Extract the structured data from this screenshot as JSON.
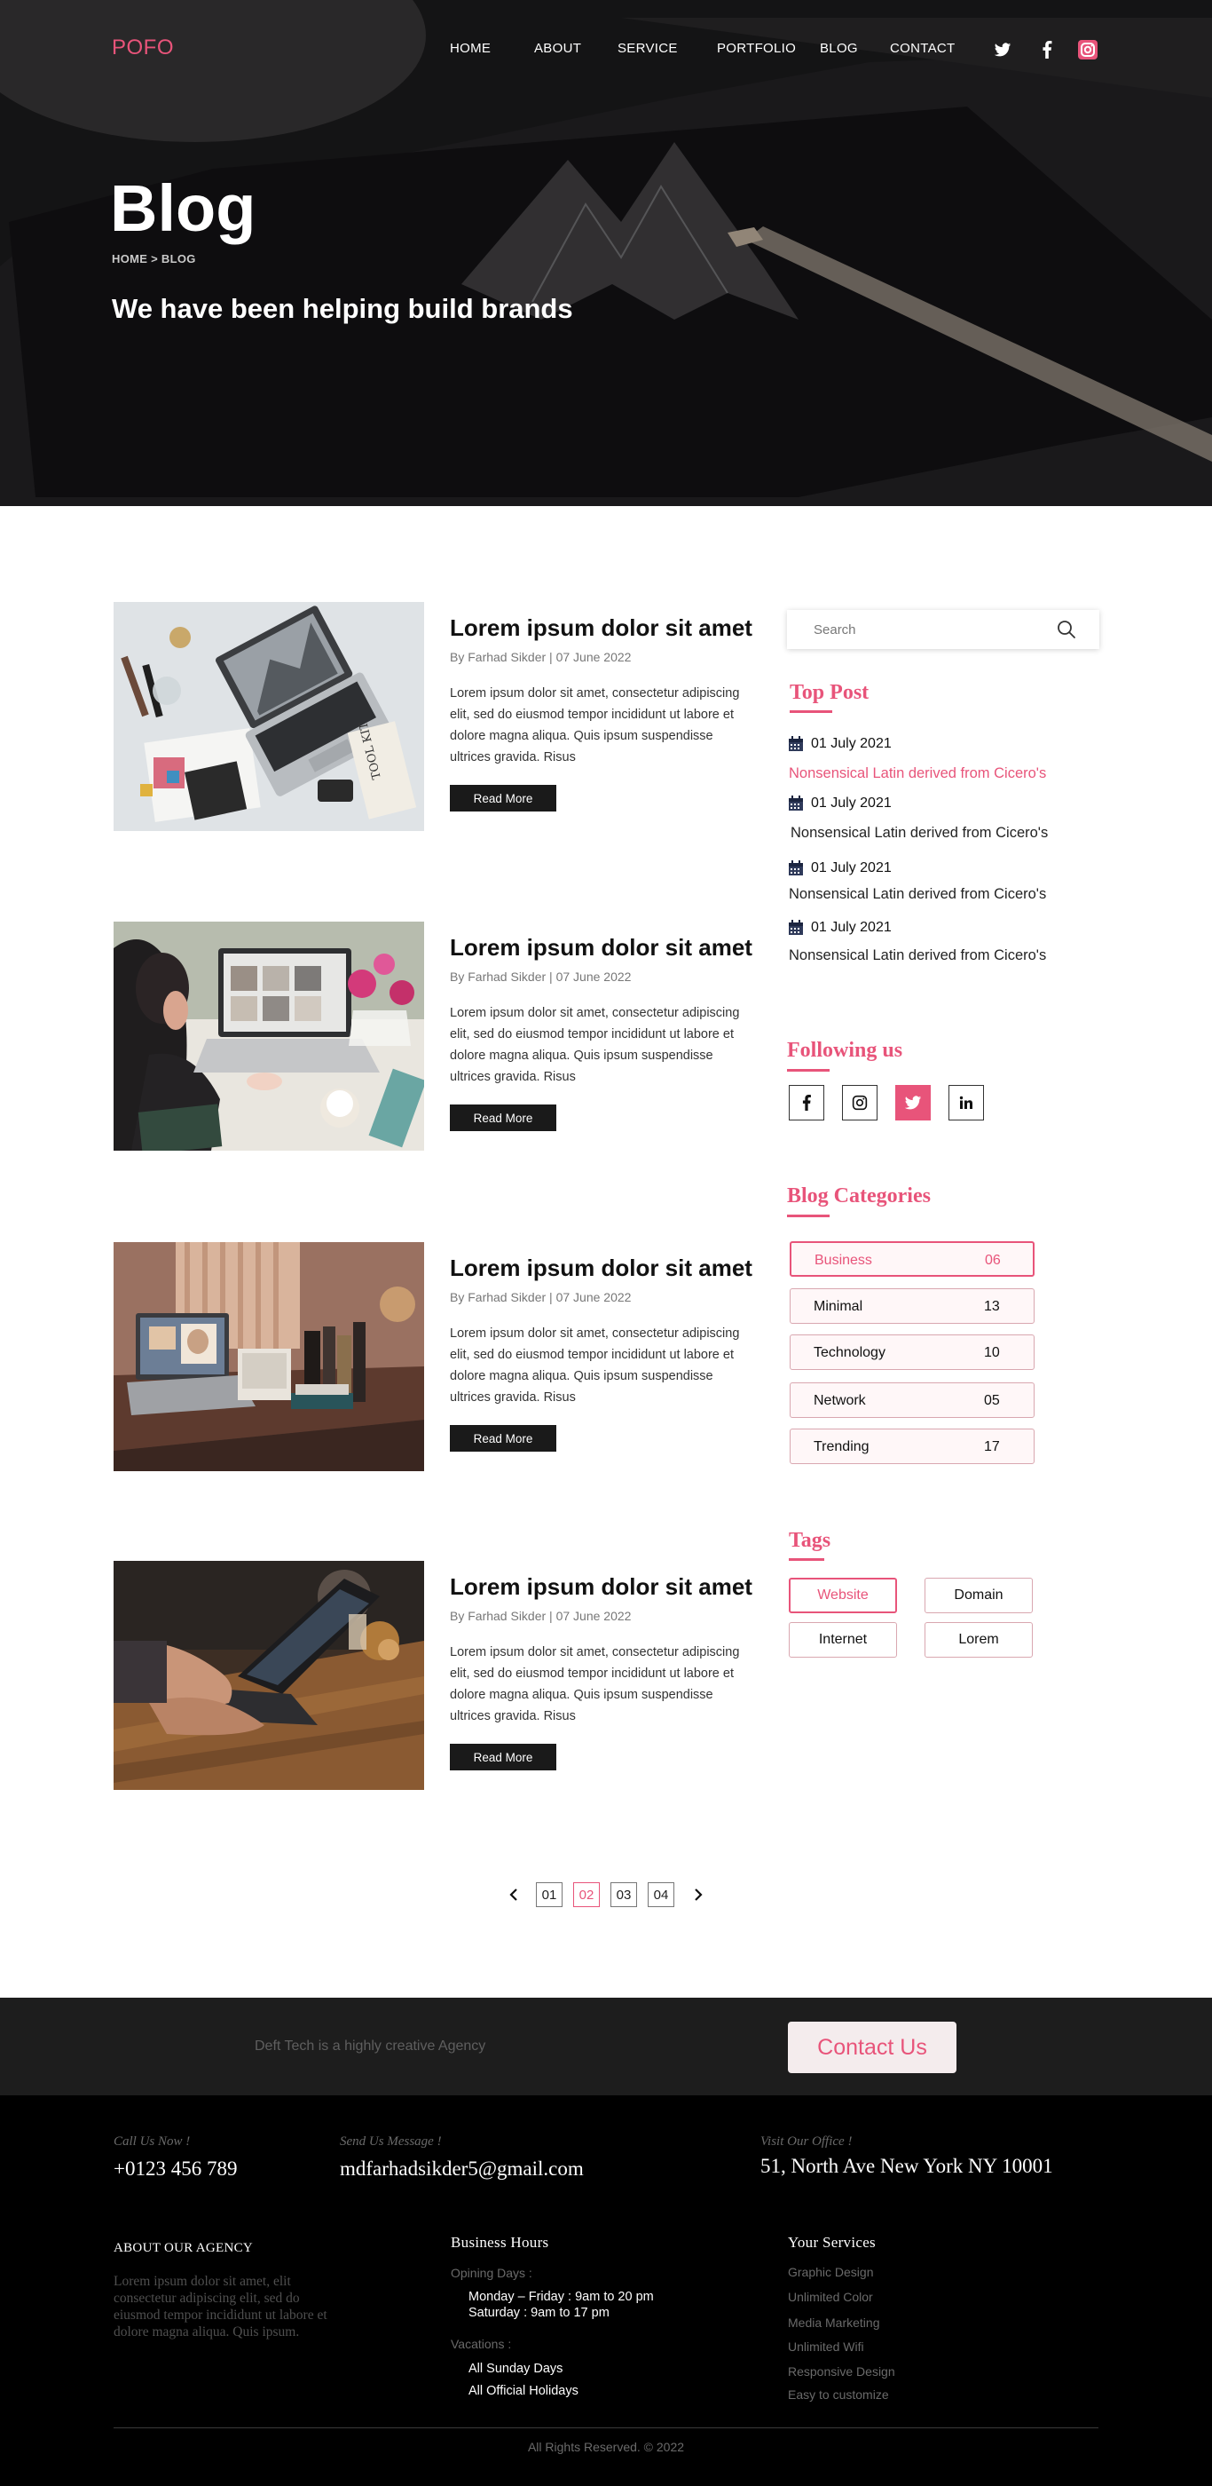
{
  "brand": {
    "logo": "POFO",
    "accent": "#e8547a"
  },
  "nav": {
    "items": [
      "HOME",
      "ABOUT",
      "SERVICE",
      "PORTFOLIO",
      "BLOG",
      "CONTACT"
    ],
    "social_icons": [
      "twitter-icon",
      "facebook-icon",
      "instagram-icon"
    ]
  },
  "hero": {
    "title": "Blog",
    "breadcrumb": "HOME > BLOG",
    "subtitle": "We have been helping build brands"
  },
  "posts": [
    {
      "title": "Lorem ipsum dolor sit amet",
      "meta": "By Farhad Sikder  |  07 June 2022",
      "excerpt": "Lorem ipsum dolor sit amet, consectetur adipiscing elit, sed do eiusmod tempor incididunt ut labore et dolore magna aliqua. Quis ipsum suspendisse ultrices gravida. Risus",
      "button": "Read More"
    },
    {
      "title": "Lorem ipsum dolor sit amet",
      "meta": "By Farhad Sikder  |  07 June 2022",
      "excerpt": "Lorem ipsum dolor sit amet, consectetur adipiscing elit, sed do eiusmod tempor incididunt ut labore et dolore magna aliqua. Quis ipsum suspendisse ultrices gravida. Risus",
      "button": "Read More"
    },
    {
      "title": "Lorem ipsum dolor sit amet",
      "meta": "By Farhad Sikder  |  07 June 2022",
      "excerpt": "Lorem ipsum dolor sit amet, consectetur adipiscing elit, sed do eiusmod tempor incididunt ut labore et dolore magna aliqua. Quis ipsum suspendisse ultrices gravida. Risus",
      "button": "Read More"
    },
    {
      "title": "Lorem ipsum dolor sit amet",
      "meta": "By Farhad Sikder  |  07 June 2022",
      "excerpt": "Lorem ipsum dolor sit amet, consectetur adipiscing elit, sed do eiusmod tempor incididunt ut labore et dolore magna aliqua. Quis ipsum suspendisse ultrices gravida. Risus",
      "button": "Read More"
    }
  ],
  "sidebar": {
    "search_placeholder": "Search",
    "top_post": {
      "heading": "Top Post",
      "items": [
        {
          "date": "01 July 2021",
          "title": "Nonsensical Latin derived  from Cicero's"
        },
        {
          "date": "01 July 2021",
          "title": "Nonsensical Latin derived  from Cicero's"
        },
        {
          "date": "01 July 2021",
          "title": "Nonsensical Latin derived  from Cicero's"
        },
        {
          "date": "01 July 2021",
          "title": "Nonsensical Latin derived  from Cicero's"
        }
      ]
    },
    "following": {
      "heading": "Following us",
      "icons": [
        "facebook-icon",
        "instagram-icon",
        "twitter-icon",
        "linkedin-icon"
      ]
    },
    "categories": {
      "heading": "Blog Categories",
      "items": [
        {
          "name": "Business",
          "count": "06"
        },
        {
          "name": "Minimal",
          "count": "13"
        },
        {
          "name": "Technology",
          "count": "10"
        },
        {
          "name": "Network",
          "count": "05"
        },
        {
          "name": "Trending",
          "count": "17"
        }
      ]
    },
    "tags": {
      "heading": "Tags",
      "items": [
        "Website",
        "Domain",
        "Internet",
        "Lorem"
      ]
    }
  },
  "pagination": {
    "pages": [
      "01",
      "02",
      "03",
      "04"
    ],
    "current": "02"
  },
  "cta": {
    "text": "Deft Tech is a highly creative Agency",
    "button": "Contact Us"
  },
  "footer": {
    "call_label": "Call Us Now !",
    "phone": "+0123 456 789",
    "message_label": "Send Us Message !",
    "email": "mdfarhadsikder5@gmail.com",
    "office_label": "Visit Our Office !",
    "address": "51, North Ave New York NY 10001",
    "about_heading": "ABOUT OUR AGENCY",
    "about_text": "Lorem ipsum dolor sit amet, elit consectetur adipiscing elit, sed do eiusmod tempor incididunt ut labore et dolore magna aliqua. Quis ipsum.",
    "hours_heading": "Business Hours",
    "opening_label": "Opining Days :",
    "opening_lines": [
      "Monday – Friday : 9am to 20 pm",
      "Saturday : 9am to 17 pm"
    ],
    "vacations_label": "Vacations :",
    "vacation_lines": [
      "All Sunday Days",
      "All Official Holidays"
    ],
    "services_heading": "Your  Services",
    "services": [
      "Graphic Design",
      "Unlimited Color",
      "Media Marketing",
      "Unlimited Wifi",
      "Responsive Design",
      "Easy to customize"
    ],
    "copyright": "All Rights Reserved. © 2022"
  }
}
